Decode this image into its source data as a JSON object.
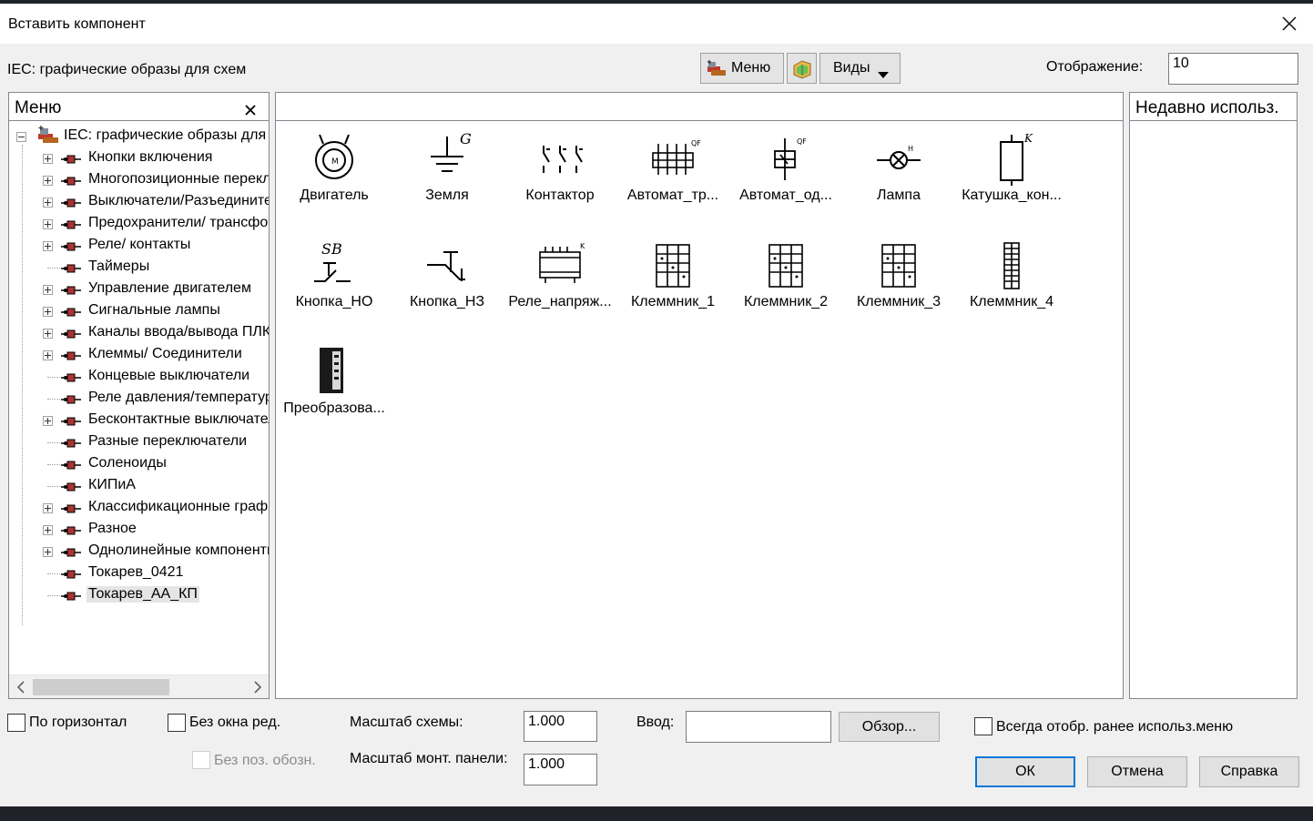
{
  "window": {
    "title": "Вставить компонент"
  },
  "toolbar": {
    "library_label": "IEC: графические образы для схем",
    "menu_button": "Меню",
    "views_button": "Виды",
    "display_label": "Отображение:",
    "display_value": "10"
  },
  "menu_panel": {
    "header": "Меню",
    "root": "IEC: графические образы для схем",
    "items": [
      {
        "label": "Кнопки включения",
        "expandable": true
      },
      {
        "label": "Многопозиционные переключатели",
        "expandable": true
      },
      {
        "label": "Выключатели/Разъединители",
        "expandable": true
      },
      {
        "label": "Предохранители/ трансформаторы",
        "expandable": true
      },
      {
        "label": "Реле/ контакты",
        "expandable": true
      },
      {
        "label": "Таймеры",
        "expandable": false
      },
      {
        "label": "Управление двигателем",
        "expandable": true
      },
      {
        "label": "Сигнальные лампы",
        "expandable": true
      },
      {
        "label": "Каналы ввода/вывода ПЛК",
        "expandable": true
      },
      {
        "label": "Клеммы/ Соединители",
        "expandable": true
      },
      {
        "label": "Концевые выключатели",
        "expandable": false
      },
      {
        "label": "Реле давления/температуры",
        "expandable": false
      },
      {
        "label": "Бесконтактные выключатели",
        "expandable": true
      },
      {
        "label": "Разные переключатели",
        "expandable": false
      },
      {
        "label": "Соленоиды",
        "expandable": false
      },
      {
        "label": "КИПиА",
        "expandable": false
      },
      {
        "label": "Классификационные графические",
        "expandable": true
      },
      {
        "label": "Разное",
        "expandable": true
      },
      {
        "label": "Однолинейные компоненты",
        "expandable": true
      },
      {
        "label": "Токарев_0421",
        "expandable": false
      },
      {
        "label": "Токарев_АА_КП",
        "expandable": false,
        "selected": true
      }
    ]
  },
  "components": [
    {
      "label": "Двигатель",
      "icon": "motor-icon"
    },
    {
      "label": "Земля",
      "icon": "ground-icon"
    },
    {
      "label": "Контактор",
      "icon": "contactor-icon"
    },
    {
      "label": "Автомат_тр...",
      "icon": "breaker-3p-icon"
    },
    {
      "label": "Автомат_од...",
      "icon": "breaker-1p-icon"
    },
    {
      "label": "Лампа",
      "icon": "lamp-icon"
    },
    {
      "label": "Катушка_кон...",
      "icon": "coil-icon"
    },
    {
      "label": "Кнопка_НО",
      "icon": "button-no-icon"
    },
    {
      "label": "Кнопка_НЗ",
      "icon": "button-nc-icon"
    },
    {
      "label": "Реле_напряж...",
      "icon": "voltage-relay-icon"
    },
    {
      "label": "Клеммник_1",
      "icon": "terminal-block-icon"
    },
    {
      "label": "Клеммник_2",
      "icon": "terminal-block-icon"
    },
    {
      "label": "Клеммник_3",
      "icon": "terminal-block-icon"
    },
    {
      "label": "Клеммник_4",
      "icon": "terminal-strip-icon"
    },
    {
      "label": "Преобразова...",
      "icon": "converter-icon"
    }
  ],
  "recent_panel": {
    "header": "Недавно использ."
  },
  "bottom": {
    "horizontal_check": "По горизонтал",
    "no_edit_check": "Без окна ред.",
    "no_pos_check": "Без поз. обозн.",
    "scheme_scale_label": "Масштаб схемы:",
    "scheme_scale_value": "1.000",
    "panel_scale_label": "Масштаб монт. панели:",
    "panel_scale_value": "1.000",
    "input_label": "Ввод:",
    "input_value": "",
    "browse_button": "Обзор...",
    "always_show_check": "Всегда отобр. ранее использ.меню",
    "ok_button": "ОК",
    "cancel_button": "Отмена",
    "help_button": "Справка"
  }
}
